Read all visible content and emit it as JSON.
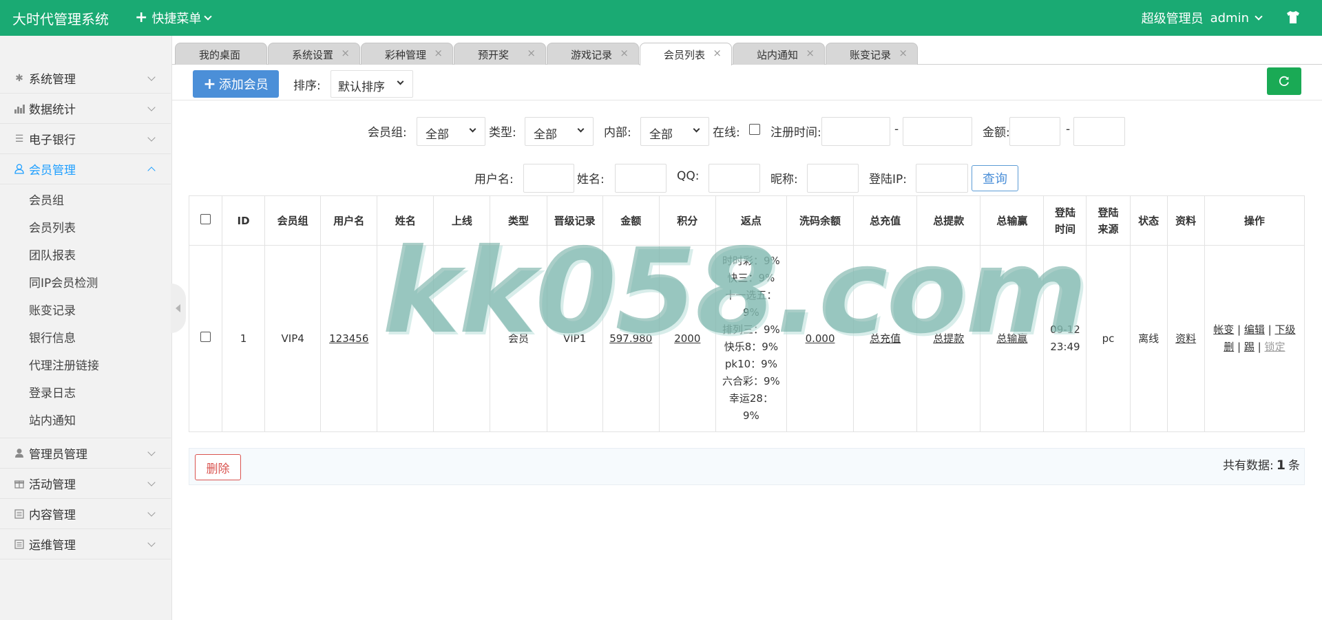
{
  "header": {
    "brand": "大时代管理系统",
    "quick_menu": "快捷菜单",
    "role": "超级管理员",
    "username": "admin"
  },
  "sidebar": {
    "items": [
      {
        "label": "系统管理",
        "icon": "gear-icon"
      },
      {
        "label": "数据统计",
        "icon": "bar-chart-icon"
      },
      {
        "label": "电子银行",
        "icon": "list-icon"
      },
      {
        "label": "会员管理",
        "icon": "user-icon"
      },
      {
        "label": "管理员管理",
        "icon": "admin-icon"
      },
      {
        "label": "活动管理",
        "icon": "gift-icon"
      },
      {
        "label": "内容管理",
        "icon": "content-icon"
      },
      {
        "label": "运维管理",
        "icon": "ops-icon"
      }
    ],
    "submenu": [
      "会员组",
      "会员列表",
      "团队报表",
      "同IP会员检测",
      "账变记录",
      "银行信息",
      "代理注册链接",
      "登录日志",
      "站内通知"
    ]
  },
  "tabs": [
    "我的桌面",
    "系统设置",
    "彩种管理",
    "预开奖",
    "游戏记录",
    "会员列表",
    "站内通知",
    "账变记录"
  ],
  "active_tab": "会员列表",
  "toolbar": {
    "add_label": "添加会员",
    "sort_label": "排序:",
    "sort_value": "默认排序"
  },
  "filters": {
    "group_label": "会员组:",
    "group_value": "全部",
    "type_label": "类型:",
    "type_value": "全部",
    "internal_label": "内部:",
    "internal_value": "全部",
    "online_label": "在线:",
    "regtime_label": "注册时间:",
    "amount_label": "金额:",
    "dash": "-",
    "username_label": "用户名:",
    "name_label": "姓名:",
    "qq_label": "QQ:",
    "nickname_label": "昵称:",
    "loginip_label": "登陆IP:",
    "query_label": "查询"
  },
  "table": {
    "columns": [
      "ID",
      "会员组",
      "用户名",
      "姓名",
      "上线",
      "类型",
      "晋级记录",
      "金额",
      "积分",
      "返点",
      "洗码余额",
      "总充值",
      "总提款",
      "总输赢",
      "登陆时间",
      "登陆来源",
      "状态",
      "资料",
      "操作"
    ],
    "rows": [
      {
        "id": "1",
        "group": "VIP4",
        "username": "123456",
        "name": "",
        "upline": "",
        "type": "会员",
        "promotion": "VIP1",
        "amount": "597.980",
        "points": "2000",
        "rebate": [
          "时时彩：9%",
          "快三：9%",
          "十一选五：",
          "9%",
          "排列三：9%",
          "快乐8：9%",
          "pk10：9%",
          "六合彩：9%",
          "幸运28：",
          "9%"
        ],
        "wash_balance": "0.000",
        "total_recharge": "总充值",
        "total_withdraw": "总提款",
        "total_winloss": "总输赢",
        "login_time_date": "09-12",
        "login_time_clock": "23:49",
        "login_source": "pc",
        "status": "离线",
        "profile": "资料",
        "actions": {
          "account": "帐变",
          "edit": "编辑",
          "sub": "下级",
          "delete": "删",
          "kick": "踢",
          "lock": "锁定",
          "sep": "|"
        }
      }
    ]
  },
  "watermark": "kk058.com",
  "footer": {
    "delete_label": "删除",
    "total_prefix": "共有数据:",
    "total_count": "1",
    "total_suffix": "条"
  },
  "colors": {
    "header_bg": "#1aaa73",
    "primary_blue": "#4b8fd8",
    "refresh_green": "#1aaa55",
    "danger_red": "#d9534f",
    "active_menu": "#1e9fff"
  }
}
